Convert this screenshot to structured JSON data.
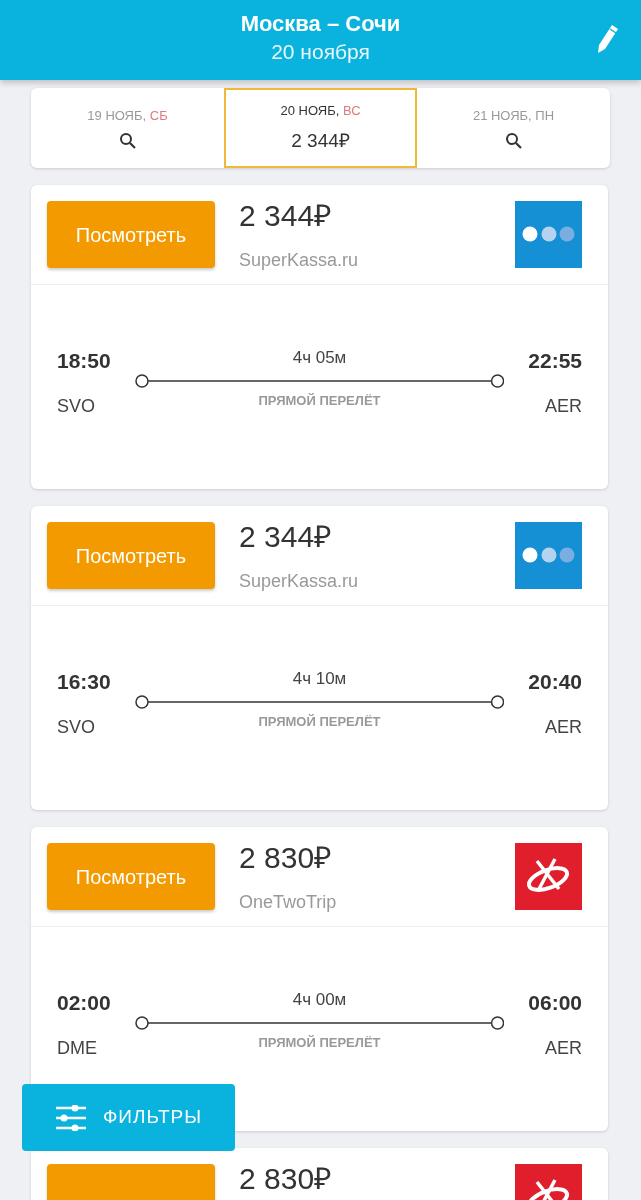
{
  "header": {
    "title": "Москва – Сочи",
    "subtitle": "20 ноября"
  },
  "date_tabs": [
    {
      "date": "19 НОЯБ,",
      "weekday": "СБ",
      "weekend": true,
      "selected": false
    },
    {
      "date": "20 НОЯБ,",
      "weekday": "ВС",
      "weekend": true,
      "selected": true,
      "price": "2 344₽"
    },
    {
      "date": "21 НОЯБ,",
      "weekday": "ПН",
      "weekend": false,
      "selected": false
    }
  ],
  "offers": [
    {
      "button": "Посмотреть",
      "price": "2 344₽",
      "seller": "SuperKassa.ru",
      "logo": {
        "kind": "dots"
      },
      "depart_time": "18:50",
      "depart_airport": "SVO",
      "duration": "4ч 05м",
      "note": "ПРЯМОЙ ПЕРЕЛЁТ",
      "arrive_time": "22:55",
      "arrive_airport": "AER"
    },
    {
      "button": "Посмотреть",
      "price": "2 344₽",
      "seller": "SuperKassa.ru",
      "logo": {
        "kind": "dots"
      },
      "depart_time": "16:30",
      "depart_airport": "SVO",
      "duration": "4ч 10м",
      "note": "ПРЯМОЙ ПЕРЕЛЁТ",
      "arrive_time": "20:40",
      "arrive_airport": "AER"
    },
    {
      "button": "Посмотреть",
      "price": "2 830₽",
      "seller": "OneTwoTrip",
      "logo": {
        "kind": "swirl"
      },
      "depart_time": "02:00",
      "depart_airport": "DME",
      "duration": "4ч 00м",
      "note": "ПРЯМОЙ ПЕРЕЛЁТ",
      "arrive_time": "06:00",
      "arrive_airport": "AER"
    },
    {
      "price": "2 830₽",
      "logo": {
        "kind": "swirl"
      }
    }
  ],
  "filter_button": {
    "label": "ФИЛЬТРЫ"
  }
}
